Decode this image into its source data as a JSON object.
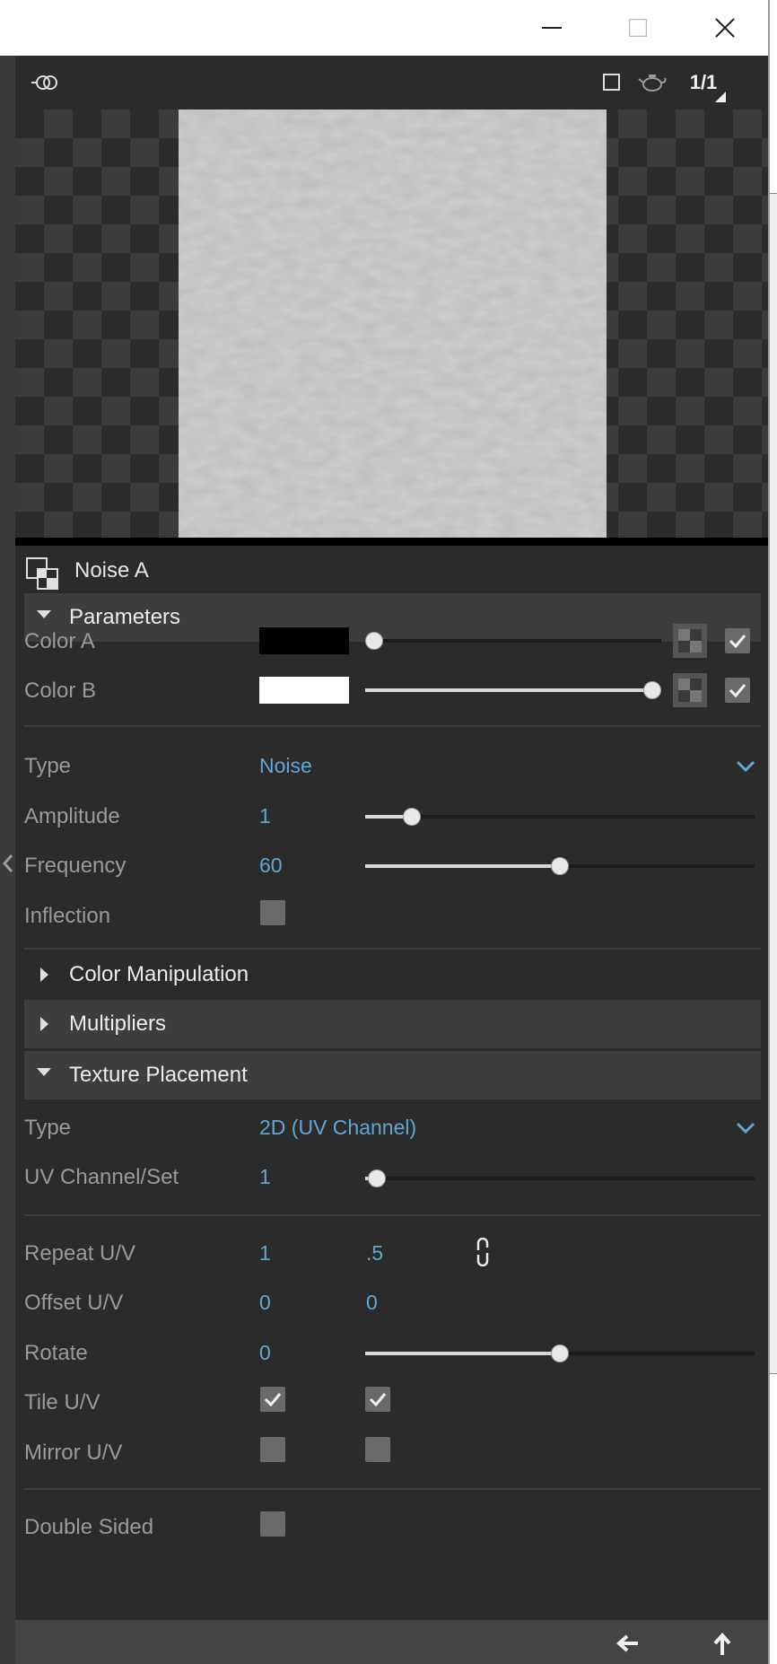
{
  "material": {
    "name": "Noise A"
  },
  "toolbar": {
    "ratio_label": "1/1"
  },
  "sections": {
    "parameters": "Parameters",
    "color_manipulation": "Color Manipulation",
    "multipliers": "Multipliers",
    "texture_placement": "Texture Placement"
  },
  "parameters": {
    "color_a": {
      "label": "Color A",
      "color": "#000000",
      "slider": 0.03,
      "enabled": true
    },
    "color_b": {
      "label": "Color B",
      "color": "#ffffff",
      "slider": 0.97,
      "enabled": true
    },
    "type": {
      "label": "Type",
      "value": "Noise"
    },
    "amplitude": {
      "label": "Amplitude",
      "value": "1",
      "slider": 0.12
    },
    "frequency": {
      "label": "Frequency",
      "value": "60",
      "slider": 0.5
    },
    "inflection": {
      "label": "Inflection",
      "checked": false
    }
  },
  "texture_placement": {
    "type": {
      "label": "Type",
      "value": "2D (UV Channel)"
    },
    "uv_channel": {
      "label": "UV Channel/Set",
      "value": "1",
      "slider": 0.03
    },
    "repeat": {
      "label": "Repeat U/V",
      "u": "1",
      "v": ".5"
    },
    "offset": {
      "label": "Offset U/V",
      "u": "0",
      "v": "0"
    },
    "rotate": {
      "label": "Rotate",
      "value": "0",
      "slider": 0.5
    },
    "tile": {
      "label": "Tile U/V",
      "u": true,
      "v": true
    },
    "mirror": {
      "label": "Mirror U/V",
      "u": false,
      "v": false
    },
    "double_sided": {
      "label": "Double Sided",
      "checked": false
    }
  },
  "icons": {
    "titlebar": [
      "minimize-icon",
      "maximize-icon",
      "close-icon"
    ],
    "toolbar": [
      "link-nodes-icon",
      "square-preview-icon",
      "teapot-icon"
    ],
    "footer": [
      "back-arrow-icon",
      "up-arrow-icon"
    ]
  },
  "colors": {
    "accent": "#5fa8d3",
    "panel": "#2b2b2b",
    "section": "#3d3d3d"
  }
}
